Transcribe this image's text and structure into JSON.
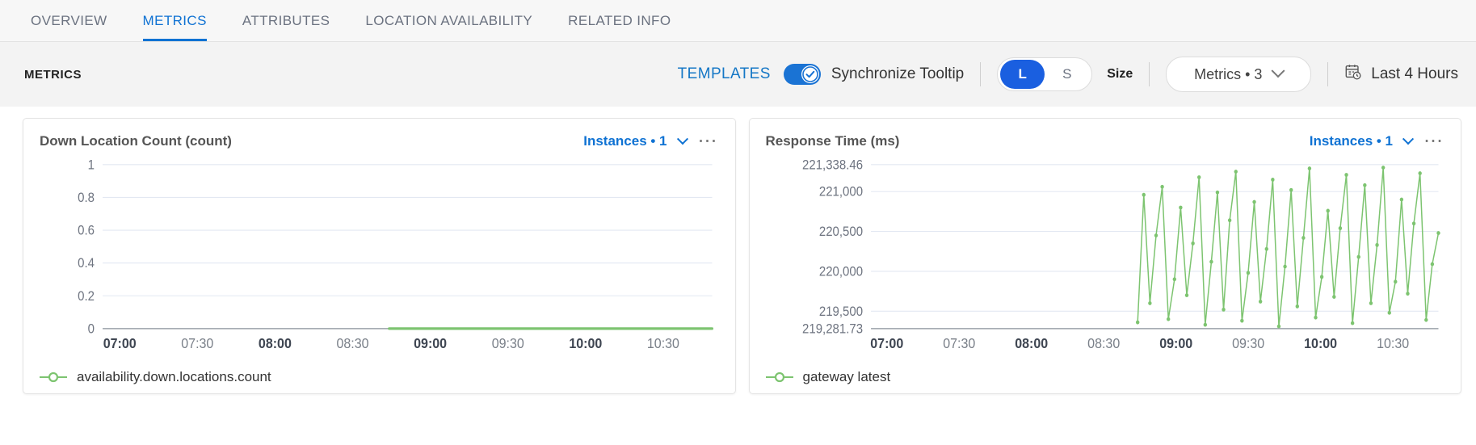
{
  "tabs": [
    {
      "label": "OVERVIEW",
      "active": false
    },
    {
      "label": "METRICS",
      "active": true
    },
    {
      "label": "ATTRIBUTES",
      "active": false
    },
    {
      "label": "LOCATION AVAILABILITY",
      "active": false
    },
    {
      "label": "RELATED INFO",
      "active": false
    }
  ],
  "toolbar": {
    "title": "METRICS",
    "templates_label": "TEMPLATES",
    "sync_tooltip_label": "Synchronize Tooltip",
    "sync_tooltip_on": true,
    "size_options": [
      "L",
      "S"
    ],
    "size_selected": "L",
    "size_label": "Size",
    "metrics_dropdown": "Metrics • 3",
    "time_range": "Last 4 Hours",
    "time_range_icon": "calendar-clock-icon",
    "accent_color": "#0f72d3",
    "toggle_color": "#1a73d4"
  },
  "cards": [
    {
      "title": "Down Location Count (count)",
      "instances_label": "Instances • 1",
      "menu_icon": "ellipsis-icon",
      "legend": "availability.down.locations.count",
      "series_color": "#7dc470"
    },
    {
      "title": "Response Time (ms)",
      "instances_label": "Instances • 1",
      "menu_icon": "ellipsis-icon",
      "legend": "gateway latest",
      "series_color": "#7dc470"
    }
  ],
  "chart_data": [
    {
      "type": "line",
      "title": "Down Location Count (count)",
      "xlabel": "",
      "ylabel": "count",
      "ylim": [
        0,
        1
      ],
      "yticks": [
        0,
        0.2,
        0.4,
        0.6,
        0.8,
        1
      ],
      "ytick_labels": [
        "0",
        "0.2",
        "0.4",
        "0.6",
        "0.8",
        "1"
      ],
      "xticks": [
        "07:00",
        "07:30",
        "08:00",
        "08:30",
        "09:00",
        "09:30",
        "10:00",
        "10:30"
      ],
      "xtick_bold": [
        true,
        false,
        true,
        false,
        true,
        false,
        true,
        false
      ],
      "grid": true,
      "legend": [
        "availability.down.locations.count"
      ],
      "legend_position": "bottom-left",
      "series": [
        {
          "name": "availability.down.locations.count",
          "color": "#7dc470",
          "x_start_frac": 0.47,
          "values": [
            0,
            0,
            0,
            0,
            0,
            0,
            0,
            0,
            0,
            0,
            0,
            0,
            0,
            0,
            0,
            0,
            0,
            0,
            0,
            0,
            0,
            0,
            0,
            0,
            0
          ]
        }
      ]
    },
    {
      "type": "line",
      "title": "Response Time (ms)",
      "xlabel": "",
      "ylabel": "ms",
      "ylim": [
        219281.73,
        221338.46
      ],
      "yticks": [
        219281.73,
        219500,
        220000,
        220500,
        221000,
        221338.46
      ],
      "ytick_labels": [
        "219,281.73",
        "219,500",
        "220,000",
        "220,500",
        "221,000",
        "221,338.46"
      ],
      "xticks": [
        "07:00",
        "07:30",
        "08:00",
        "08:30",
        "09:00",
        "09:30",
        "10:00",
        "10:30"
      ],
      "xtick_bold": [
        true,
        false,
        true,
        false,
        true,
        false,
        true,
        false
      ],
      "grid": true,
      "legend": [
        "gateway latest"
      ],
      "legend_position": "bottom-left",
      "series": [
        {
          "name": "gateway latest",
          "color": "#7dc470",
          "x_start_frac": 0.47,
          "values": [
            219360,
            220960,
            219600,
            220450,
            221060,
            219400,
            219900,
            220800,
            219700,
            220350,
            221180,
            219330,
            220120,
            220990,
            219520,
            220640,
            221250,
            219380,
            219980,
            220870,
            219620,
            220280,
            221150,
            219310,
            220060,
            221020,
            219560,
            220420,
            221290,
            219420,
            219930,
            220760,
            219680,
            220540,
            221210,
            219350,
            220180,
            221080,
            219600,
            220330,
            221300,
            219480,
            219870,
            220900,
            219720,
            220600,
            221230,
            219390,
            220090,
            220480
          ]
        }
      ]
    }
  ]
}
